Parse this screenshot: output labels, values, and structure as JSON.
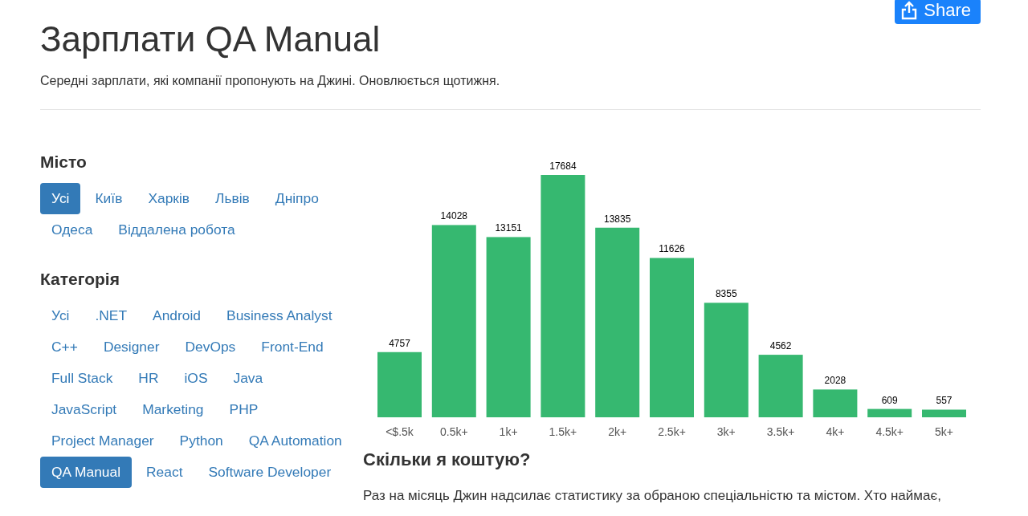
{
  "share_button": {
    "label": "Share"
  },
  "title": "Зарплати QA Manual",
  "subtitle": "Середні зарплати, які компанії пропонують на Джині. Оновлюється щотижня.",
  "filters": [
    {
      "heading": "Місто",
      "items": [
        {
          "label": "Усі",
          "selected": true
        },
        {
          "label": "Київ",
          "selected": false
        },
        {
          "label": "Харків",
          "selected": false
        },
        {
          "label": "Львів",
          "selected": false
        },
        {
          "label": "Дніпро",
          "selected": false
        },
        {
          "label": "Одеса",
          "selected": false
        },
        {
          "label": "Віддалена робота",
          "selected": false
        }
      ]
    },
    {
      "heading": "Категорія",
      "items": [
        {
          "label": "Усі",
          "selected": false
        },
        {
          "label": ".NET",
          "selected": false
        },
        {
          "label": "Android",
          "selected": false
        },
        {
          "label": "Business Analyst",
          "selected": false
        },
        {
          "label": "C++",
          "selected": false
        },
        {
          "label": "Designer",
          "selected": false
        },
        {
          "label": "DevOps",
          "selected": false
        },
        {
          "label": "Front-End",
          "selected": false
        },
        {
          "label": "Full Stack",
          "selected": false
        },
        {
          "label": "HR",
          "selected": false
        },
        {
          "label": "iOS",
          "selected": false
        },
        {
          "label": "Java",
          "selected": false
        },
        {
          "label": "JavaScript",
          "selected": false
        },
        {
          "label": "Marketing",
          "selected": false
        },
        {
          "label": "PHP",
          "selected": false
        },
        {
          "label": "Project Manager",
          "selected": false
        },
        {
          "label": "Python",
          "selected": false
        },
        {
          "label": "QA Automation",
          "selected": false
        },
        {
          "label": "QA Manual",
          "selected": true
        },
        {
          "label": "React",
          "selected": false
        },
        {
          "label": "Software Developer",
          "selected": false
        }
      ]
    }
  ],
  "chart_data": {
    "type": "bar",
    "categories": [
      "<$.5k",
      "0.5k+",
      "1k+",
      "1.5k+",
      "2k+",
      "2.5k+",
      "3k+",
      "3.5k+",
      "4k+",
      "4.5k+",
      "5k+"
    ],
    "values": [
      4757,
      14028,
      13151,
      17684,
      13835,
      11626,
      8355,
      4562,
      2028,
      609,
      557
    ],
    "data_labels": true
  },
  "section": {
    "heading": "Скільки я коштую?",
    "text": "Раз на місяць Джин надсилає статистику за обраною спеціальністю та містом. Хто наймає,"
  }
}
